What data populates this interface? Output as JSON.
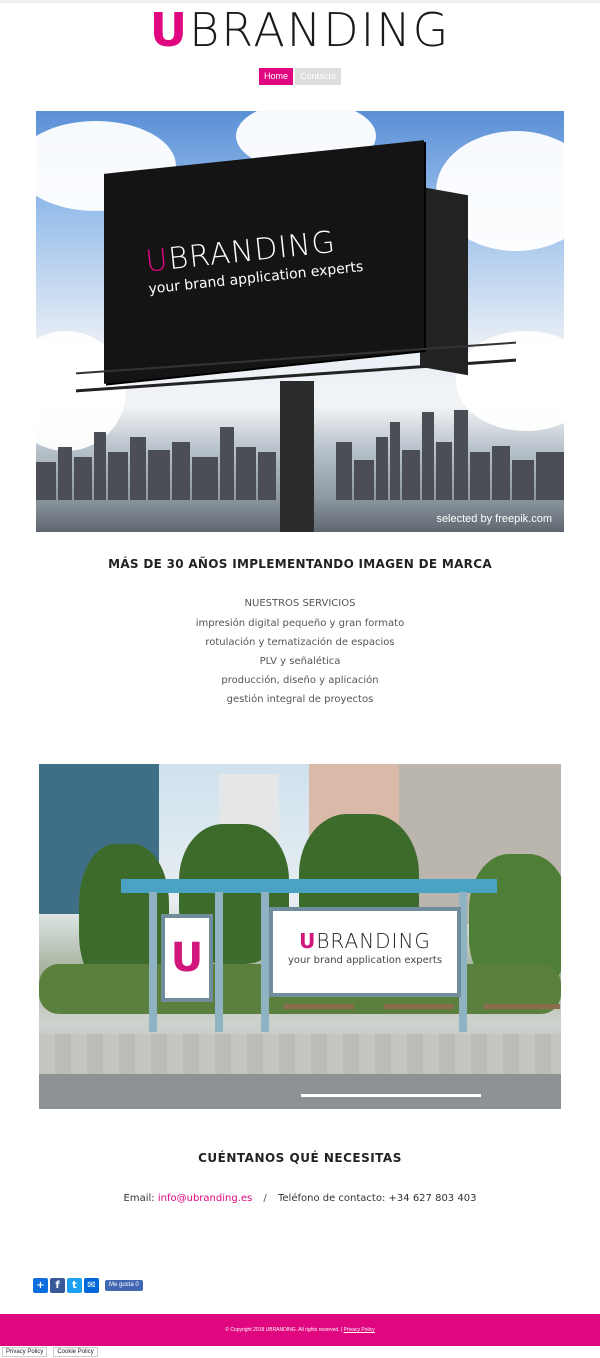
{
  "brand": {
    "initial": "U",
    "rest": "BRANDING",
    "accent_color": "#e0067f"
  },
  "nav": {
    "items": [
      {
        "label": "Home",
        "active": true
      },
      {
        "label": "Contacto",
        "active": false
      }
    ]
  },
  "hero": {
    "billboard_brand_initial": "U",
    "billboard_brand_rest": "BRANDING",
    "billboard_tagline": "your brand application experts",
    "credit": "selected by  freepik.com"
  },
  "headline": "MÁS DE 30 AÑOS IMPLEMENTANDO IMAGEN DE MARCA",
  "services": {
    "title": "NUESTROS SERVICIOS",
    "items": [
      "impresión digital pequeño y gran formato",
      "rotulación y tematización de espacios",
      "PLV y señalética",
      "producción, diseño y aplicación",
      "gestión integral de proyectos"
    ]
  },
  "bus_stop": {
    "small_panel_letter": "U",
    "brand_initial": "U",
    "brand_rest": "BRANDING",
    "tagline": "your brand application experts"
  },
  "cta_heading": "CUÉNTANOS QUÉ NECESITAS",
  "contact": {
    "email_label": "Email:",
    "email": "info@ubranding.es",
    "separator": "/",
    "phone_label": "Teléfono de contacto:",
    "phone": "+34 627 803 403"
  },
  "share": {
    "icons": [
      "add-icon",
      "facebook-icon",
      "twitter-icon",
      "mail-icon"
    ],
    "like_label": "Me gusta 0"
  },
  "footer": {
    "copyright": "© Copyright 2018 UBRANDING. All rights reserved. |",
    "privacy_link": "Privacy Policy"
  },
  "bottom_links": {
    "privacy": "Privacy Policy",
    "cookie": "Cookie Policy"
  }
}
